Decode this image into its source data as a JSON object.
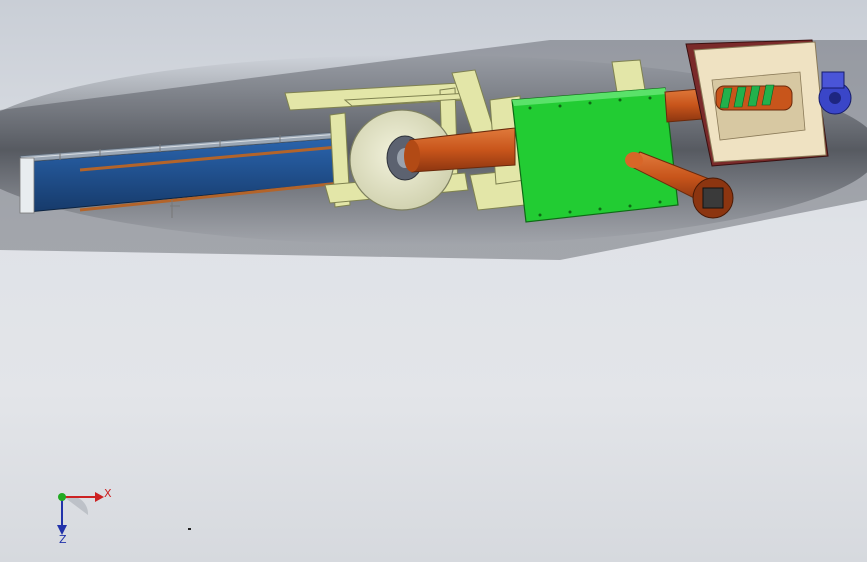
{
  "viewport": {
    "background_top": "#c9ced6",
    "background_bottom": "#d6d9de"
  },
  "model": {
    "conveyor_color": "#1f4e8c",
    "frame_color": "#e3e6a8",
    "housing_color": "#22cc33",
    "pipe_color": "#c8551b",
    "hopper_color": "#efe2c2",
    "screw_color": "#22b14c",
    "motor_color": "#3a46c8"
  },
  "triad": {
    "x_label": "X",
    "z_label": "Z",
    "x_color": "#cc2222",
    "y_color": "#22aa22",
    "z_color": "#2233aa"
  }
}
